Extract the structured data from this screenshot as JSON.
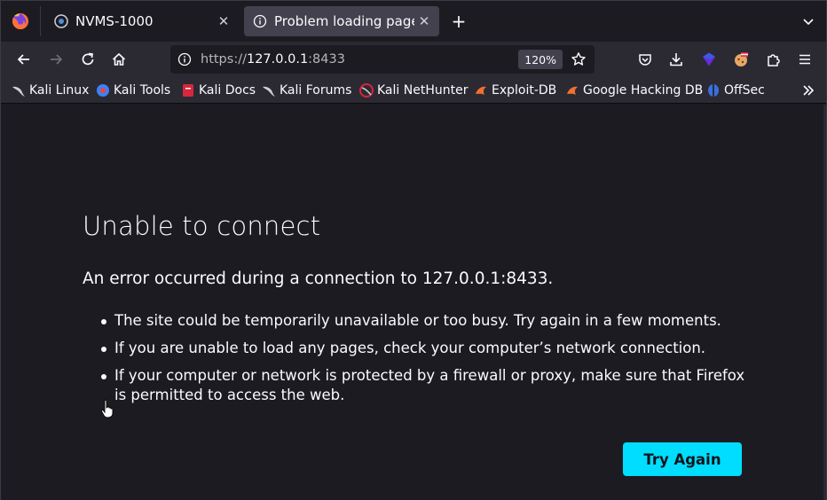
{
  "browser": {
    "tabs": [
      {
        "title": "NVMS-1000",
        "close": "✕",
        "active": false
      },
      {
        "title": "Problem loading page",
        "close": "✕",
        "active": true
      }
    ],
    "new_tab": "+",
    "url": {
      "scheme": "https://",
      "host": "127.0.0.1",
      "port": ":8433"
    },
    "zoom": "120%",
    "bookmarks": [
      {
        "label": "Kali Linux",
        "icon": "kali-dragon-icon"
      },
      {
        "label": "Kali Tools",
        "icon": "kali-tools-icon"
      },
      {
        "label": "Kali Docs",
        "icon": "kali-docs-icon"
      },
      {
        "label": "Kali Forums",
        "icon": "kali-dragon-icon"
      },
      {
        "label": "Kali NetHunter",
        "icon": "nethunter-icon"
      },
      {
        "label": "Exploit-DB",
        "icon": "exploit-db-icon"
      },
      {
        "label": "Google Hacking DB",
        "icon": "exploit-db-icon"
      },
      {
        "label": "OffSec",
        "icon": "offsec-icon"
      }
    ]
  },
  "error_page": {
    "title": "Unable to connect",
    "description": "An error occurred during a connection to 127.0.0.1:8433.",
    "items": [
      "The site could be temporarily unavailable or too busy. Try again in a few moments.",
      "If you are unable to load any pages, check your computer’s network connection.",
      "If your computer or network is protected by a firewall or proxy, make sure that Firefox is permitted to access the web."
    ],
    "button": "Try Again"
  },
  "colors": {
    "accent": "#00ddff",
    "toolbar": "#2b2a33",
    "page_bg": "#1c1b22",
    "active_tab": "#42414d"
  }
}
